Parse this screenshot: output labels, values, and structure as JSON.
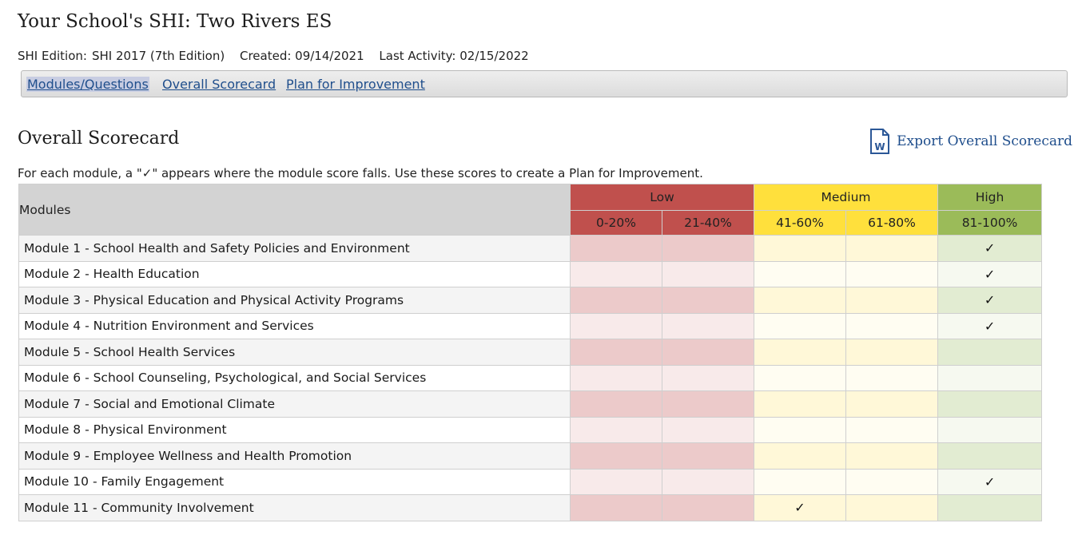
{
  "header": {
    "title": "Your School's SHI: Two Rivers ES",
    "edition_label": "SHI Edition:",
    "edition_value": "SHI 2017 (7th Edition)",
    "created": "Created: 09/14/2021",
    "last_activity": "Last Activity: 02/15/2022"
  },
  "nav": {
    "tabs": [
      {
        "label": "Modules/Questions"
      },
      {
        "label": "Overall Scorecard"
      },
      {
        "label": "Plan for Improvement"
      }
    ]
  },
  "section": {
    "title": "Overall Scorecard",
    "export_label": "Export Overall Scorecard",
    "export_icon_letter": "W",
    "instructions": "For each module, a \"✓\" appears where the module score falls. Use these scores to create a Plan for Improvement."
  },
  "table": {
    "modules_header": "Modules",
    "groups": [
      "Low",
      "Medium",
      "High"
    ],
    "ranges": [
      "0-20%",
      "21-40%",
      "41-60%",
      "61-80%",
      "81-100%"
    ],
    "check_symbol": "✓",
    "rows": [
      {
        "name": "Module 1 - School Health and Safety Policies and Environment",
        "score_band": 4
      },
      {
        "name": "Module 2 - Health Education",
        "score_band": 4
      },
      {
        "name": "Module 3 - Physical Education and Physical Activity Programs",
        "score_band": 4
      },
      {
        "name": "Module 4 - Nutrition Environment and Services",
        "score_band": 4
      },
      {
        "name": "Module 5 - School Health Services",
        "score_band": null
      },
      {
        "name": "Module 6 - School Counseling, Psychological, and Social Services",
        "score_band": null
      },
      {
        "name": "Module 7 - Social and Emotional Climate",
        "score_band": null
      },
      {
        "name": "Module 8 - Physical Environment",
        "score_band": null
      },
      {
        "name": "Module 9 - Employee Wellness and Health Promotion",
        "score_band": null
      },
      {
        "name": "Module 10 - Family Engagement",
        "score_band": 4
      },
      {
        "name": "Module 11 - Community Involvement",
        "score_band": 2
      }
    ]
  },
  "colors": {
    "low": "#c0504d",
    "medium": "#ffe03c",
    "high": "#9bbb59",
    "link": "#1f4e8c",
    "word_icon": "#2b5797"
  }
}
